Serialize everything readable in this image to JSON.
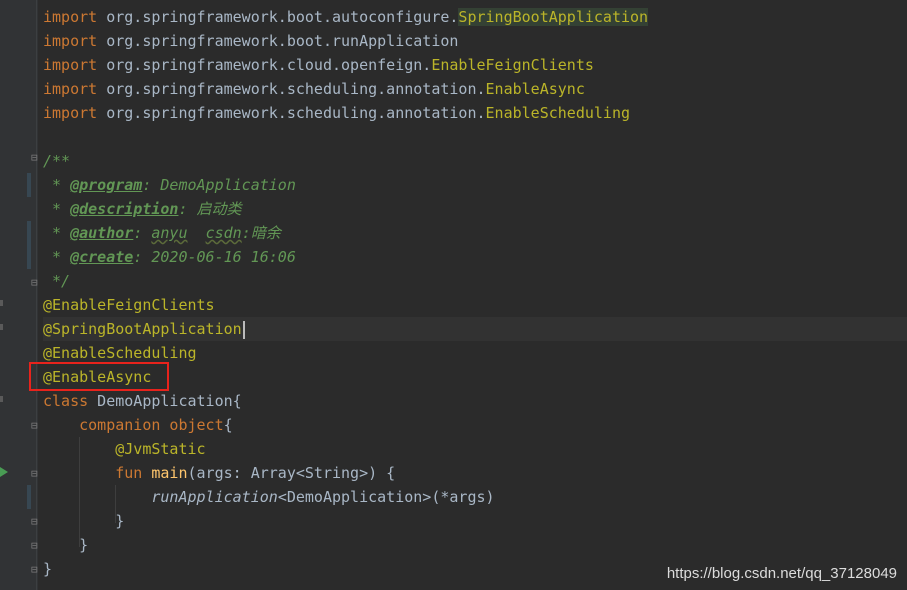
{
  "editor": {
    "imports": [
      {
        "prefix": "org.springframework.boot.autoconfigure.",
        "cls": "SpringBootApplication"
      },
      {
        "prefix": "org.springframework.boot.runApplication",
        "cls": ""
      },
      {
        "prefix": "org.springframework.cloud.openfeign.",
        "cls": "EnableFeignClients"
      },
      {
        "prefix": "org.springframework.scheduling.annotation.",
        "cls": "EnableAsync"
      },
      {
        "prefix": "org.springframework.scheduling.annotation.",
        "cls": "EnableScheduling"
      }
    ],
    "import_kw": "import",
    "doc": {
      "open": "/**",
      "program_tag": "@program",
      "program_val": ": DemoApplication",
      "description_tag": "@description",
      "description_val": ": 启动类",
      "author_tag": "@author",
      "author_sep": ": ",
      "author_name": "anyu",
      "author_gap": "  ",
      "author_site": "csdn",
      "author_rest": ":暗余",
      "create_tag": "@create",
      "create_val": ": 2020-06-16 16:06",
      "close": " */",
      "star": " * "
    },
    "annotations": [
      "@EnableFeignClients",
      "@SpringBootApplication",
      "@EnableScheduling",
      "@EnableAsync"
    ],
    "class_kw": "class",
    "class_rest": " DemoApplication{",
    "companion_kw": "companion object",
    "companion_rest": "{",
    "jvmstatic": "@JvmStatic",
    "fun_kw": "fun",
    "fun_name": "main",
    "fun_rest": "(args: Array<String>) {",
    "run_call": "runApplication",
    "run_rest": "<DemoApplication>(*args)",
    "close_inner": "}",
    "close_mid": "}",
    "close_outer": "}"
  },
  "watermark": "https://blog.csdn.net/qq_37128049"
}
